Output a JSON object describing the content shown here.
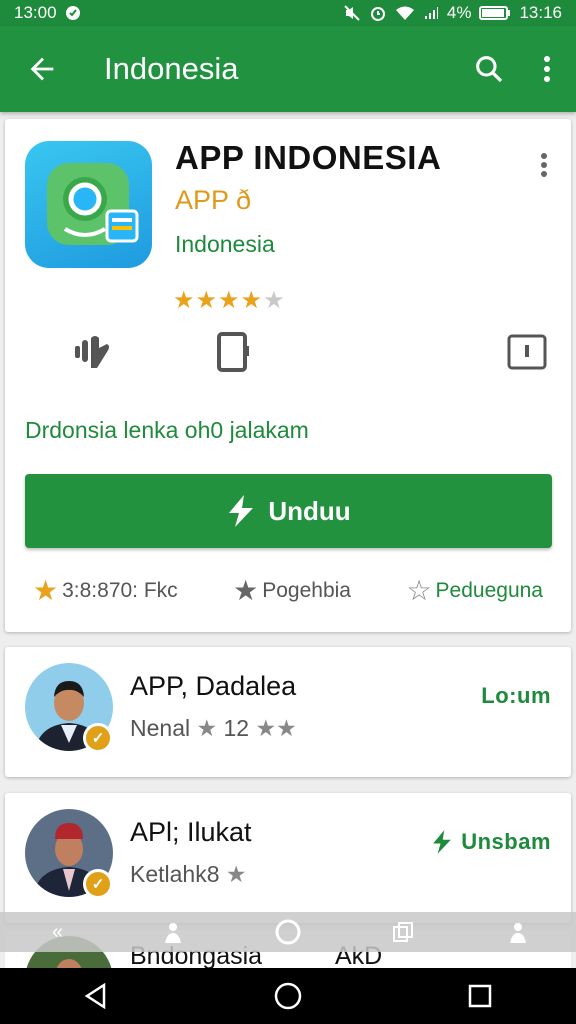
{
  "status": {
    "time_left": "13:00",
    "battery": "4%",
    "time_right": "13:16"
  },
  "appbar": {
    "title": "Indonesia"
  },
  "app": {
    "name": "APP INDONESIA",
    "developer": "APP ð",
    "category": "Indonesia",
    "rating_stars": 4,
    "rating_max": 5,
    "description": "Drdonsia lenka oh0 jalakam",
    "install_label": "Unduu",
    "info": [
      {
        "icon": "star-icon",
        "label": "3:8:870: Fkc"
      },
      {
        "icon": "star-icon",
        "label": "Pogehbia"
      },
      {
        "icon": "star-outline-icon",
        "label": "Pedueguna"
      }
    ]
  },
  "reviews": [
    {
      "name": "APP, Dadalea",
      "meta_text": "Nenal",
      "meta_count": "12",
      "action": "Lo:um"
    },
    {
      "name": "APl; Ilukat",
      "meta_text": "Ketlahk8",
      "action": "Unsbam"
    }
  ],
  "peek": {
    "name": "Bndongasia",
    "aux": "AkD"
  },
  "colors": {
    "primary": "#21923f",
    "accent": "#e9a21b",
    "status_bar": "#1e8a3c"
  }
}
